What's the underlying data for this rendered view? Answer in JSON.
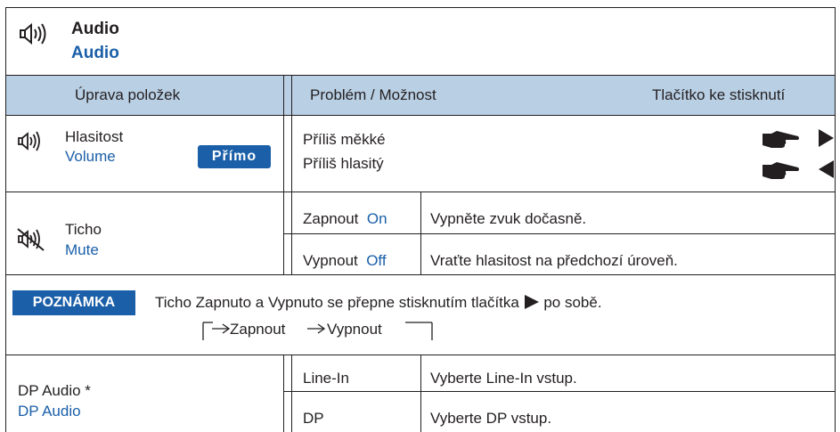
{
  "title": {
    "primary": "Audio",
    "secondary": "Audio"
  },
  "header": {
    "col_adjust": "Úprava položek",
    "col_problem": "Problém / Možnost",
    "col_button": "Tlačítko ke stisknutí"
  },
  "volume": {
    "label": "Hlasitost",
    "label_en": "Volume",
    "badge": "Přímo",
    "too_soft": "Příliš měkké",
    "too_loud": "Příliš hlasitý"
  },
  "mute": {
    "label": "Ticho",
    "label_en": "Mute",
    "on_label": "Zapnout",
    "on_en": "On",
    "on_desc": "Vypněte zvuk dočasně.",
    "off_label": "Vypnout",
    "off_en": "Off",
    "off_desc": "Vraťte hlasitost na předchozí úroveň."
  },
  "note": {
    "badge": "POZNÁMKA",
    "text_before": "Ticho Zapnuto a Vypnuto se přepne stisknutím tlačítka",
    "text_after": "po sobě.",
    "cycle_a": "Zapnout",
    "cycle_b": "Vypnout"
  },
  "dp_audio": {
    "label": "DP Audio *",
    "label_en": "DP Audio",
    "opt1": "Line-In",
    "opt1_desc": "Vyberte Line-In vstup.",
    "opt2": "DP",
    "opt2_desc": "Vyberte DP vstup."
  },
  "colors": {
    "accent": "#1a5fa8",
    "header_bg": "#b9cfe4",
    "ink": "#231f20"
  }
}
